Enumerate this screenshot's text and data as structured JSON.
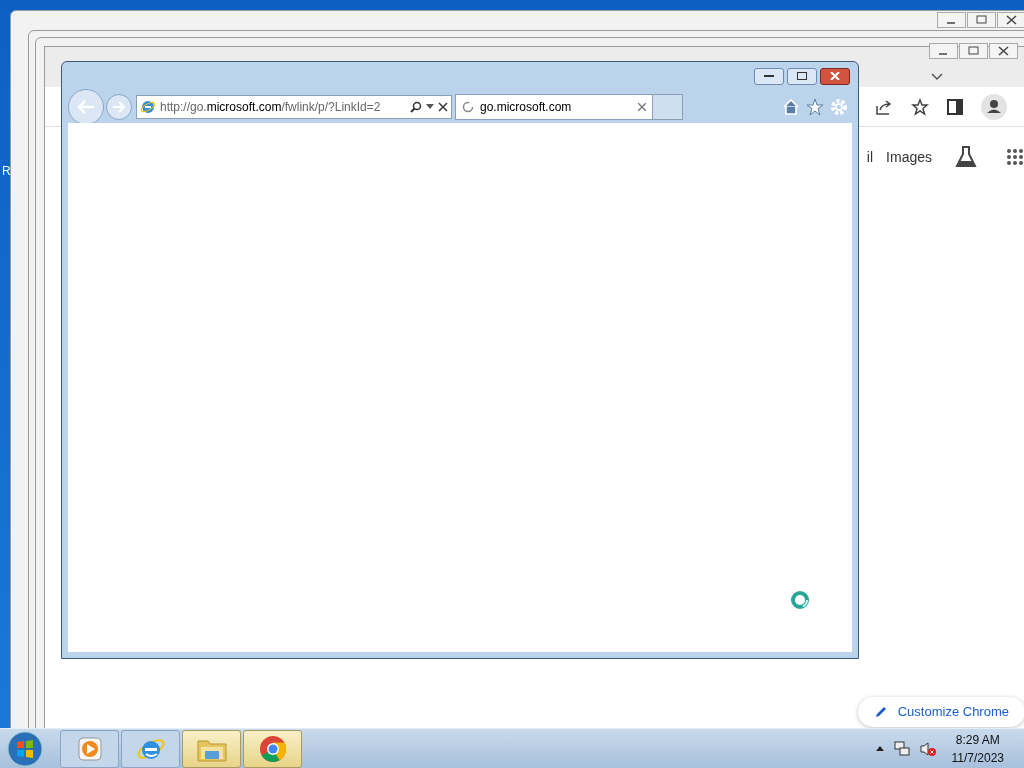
{
  "desktop": {
    "icon_label": "R"
  },
  "chrome": {
    "links": [
      "il",
      "Images"
    ],
    "customize": "Customize Chrome"
  },
  "ie": {
    "address": "http://go.**microsoft.com**/fwlink/p/?LinkId=2",
    "tab": {
      "title": "go.microsoft.com",
      "loading": true
    },
    "busy": true
  },
  "taskbar": {
    "apps": [
      {
        "kind": "media",
        "active": false
      },
      {
        "kind": "ie",
        "active": false
      },
      {
        "kind": "explorer",
        "active": true
      },
      {
        "kind": "chrome",
        "active": true
      }
    ],
    "time": "8:29 AM",
    "date": "11/7/2023"
  }
}
